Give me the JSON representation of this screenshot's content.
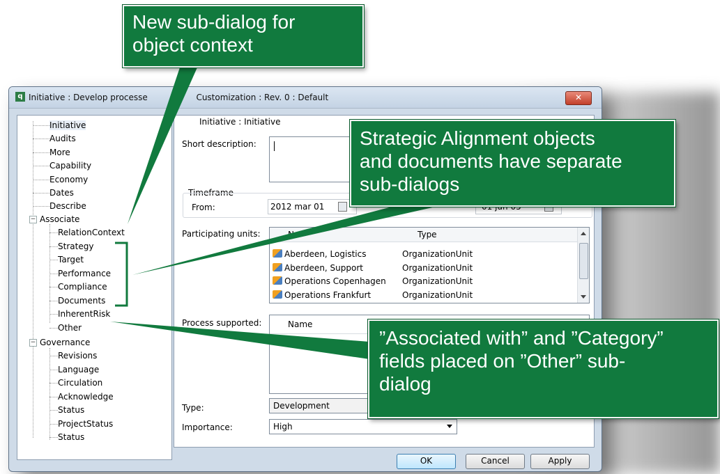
{
  "window": {
    "title": "Initiative : Develop processe",
    "title_suffix": "Customization : Rev. 0  : Default",
    "close_label": "✕"
  },
  "tree": {
    "top_items": [
      "Initiative",
      "Audits",
      "More",
      "Capability",
      "Economy",
      "Dates",
      "Describe"
    ],
    "associate_label": "Associate",
    "associate_children": [
      "RelationContext",
      "Strategy",
      "Target",
      "Performance",
      "Compliance",
      "Documents",
      "InherentRisk",
      "Other"
    ],
    "governance_label": "Governance",
    "governance_children": [
      "Revisions",
      "Language",
      "Circulation",
      "Acknowledge",
      "Status",
      "ProjectStatus",
      "Status"
    ]
  },
  "form": {
    "header": "Initiative : Initiative",
    "short_description_label": "Short description:",
    "timeframe_label": "Timeframe",
    "from_label": "From:",
    "from_value": "2012 mar 01",
    "to_value_partial": "01 jun 05",
    "participating_units_label": "Participating units:",
    "units_columns": [
      "N",
      "Type"
    ],
    "units": [
      {
        "name": "Aberdeen, Logistics",
        "type": "OrganizationUnit"
      },
      {
        "name": "Aberdeen, Support",
        "type": "OrganizationUnit"
      },
      {
        "name": "Operations Copenhagen",
        "type": "OrganizationUnit"
      },
      {
        "name": "Operations Frankfurt",
        "type": "OrganizationUnit"
      }
    ],
    "process_supported_label": "Process supported:",
    "process_columns": [
      "Name"
    ],
    "type_label": "Type:",
    "type_value": "Development",
    "importance_label": "Importance:",
    "importance_value": "High"
  },
  "buttons": {
    "ok": "OK",
    "cancel": "Cancel",
    "apply": "Apply"
  },
  "callouts": {
    "new_subdialog": [
      "New sub-dialog for",
      "object context"
    ],
    "strategic": [
      "Strategic Alignment objects",
      "and documents have separate",
      "sub-dialogs"
    ],
    "associated": [
      "”Associated with” and ”Category”",
      "fields placed on ”Other” sub-",
      "dialog"
    ]
  },
  "colors": {
    "callout_green": "#117a3e",
    "window_frame": "#cfdbe8"
  }
}
